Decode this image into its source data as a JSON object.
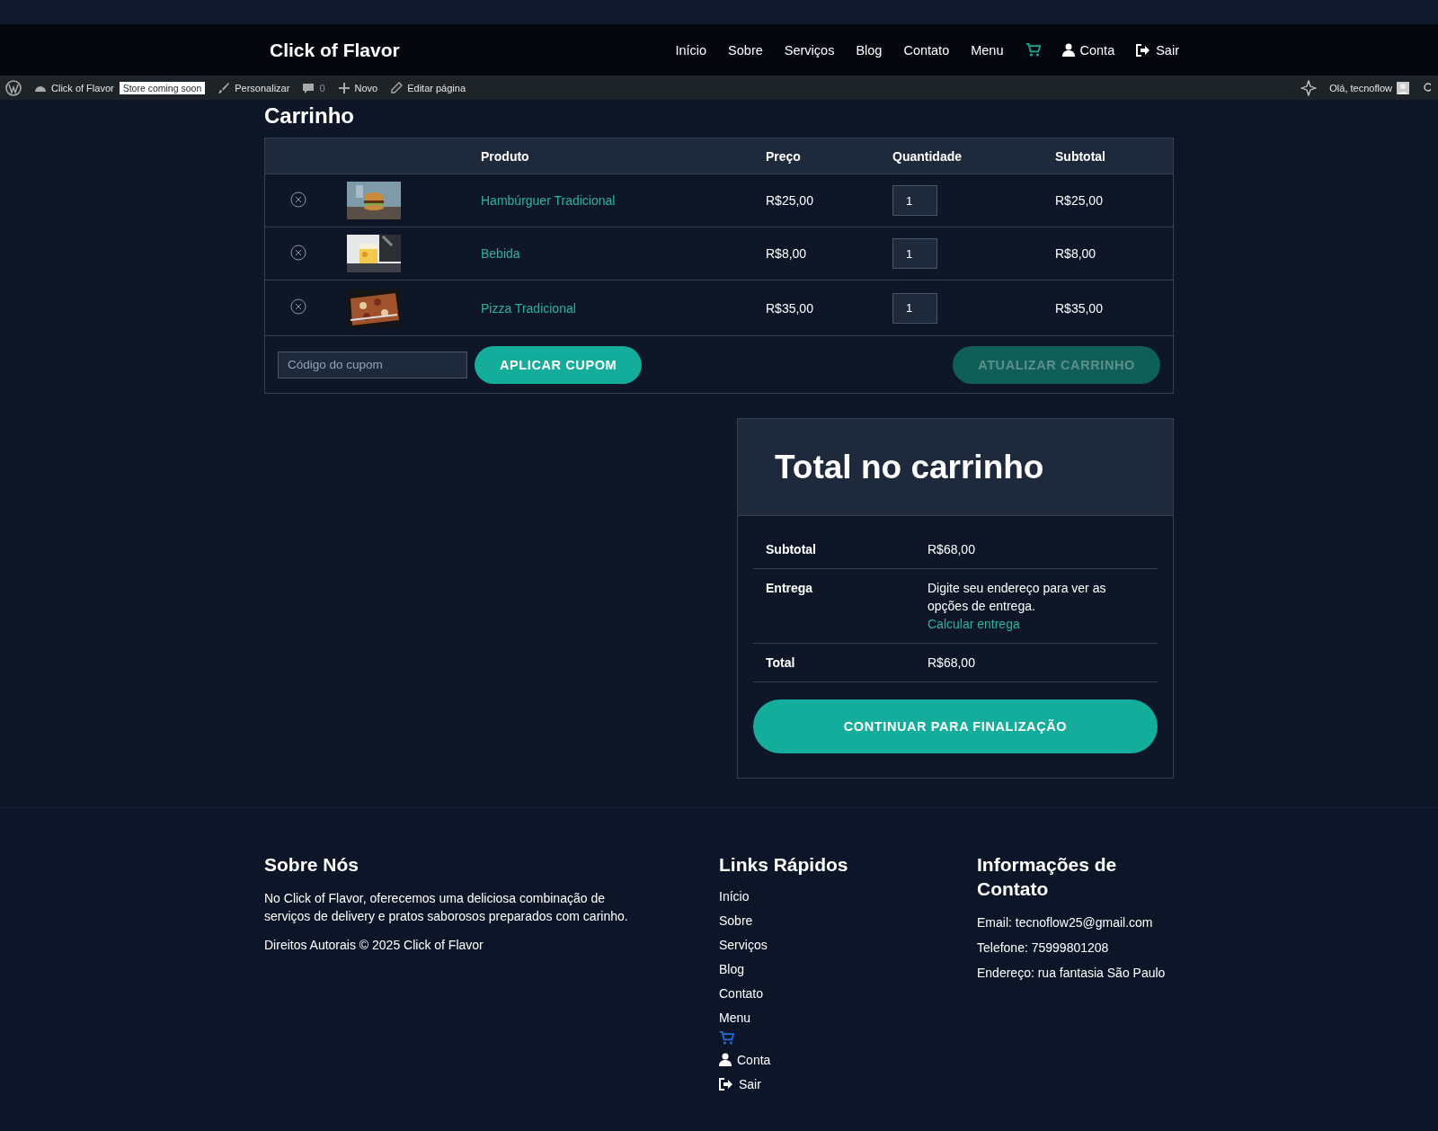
{
  "site": {
    "title": "Click of Flavor"
  },
  "nav": [
    {
      "kind": "text",
      "label": "Início"
    },
    {
      "kind": "text",
      "label": "Sobre"
    },
    {
      "kind": "text",
      "label": "Serviços"
    },
    {
      "kind": "text",
      "label": "Blog"
    },
    {
      "kind": "text",
      "label": "Contato"
    },
    {
      "kind": "text",
      "label": "Menu"
    },
    {
      "kind": "cart"
    },
    {
      "kind": "account",
      "label": "Conta"
    },
    {
      "kind": "logout",
      "label": "Sair"
    }
  ],
  "admin_bar": {
    "items": [
      {
        "kind": "wp"
      },
      {
        "kind": "site",
        "label": "Click of Flavor"
      },
      {
        "kind": "badge",
        "label": "Store coming soon"
      },
      {
        "kind": "customize",
        "label": "Personalizar"
      },
      {
        "kind": "comments",
        "label": "0"
      },
      {
        "kind": "new",
        "label": "Novo"
      },
      {
        "kind": "edit",
        "label": "Editar página"
      }
    ],
    "greeting": "Olá, tecnoflow"
  },
  "cart": {
    "heading": "Carrinho",
    "columns": [
      "Produto",
      "Preço",
      "Quantidade",
      "Subtotal"
    ],
    "rows": [
      {
        "product": "Hambúrguer Tradicional",
        "price": "R$25,00",
        "quantity": "1",
        "subtotal": "R$25,00"
      },
      {
        "product": "Bebida",
        "price": "R$8,00",
        "quantity": "1",
        "subtotal": "R$8,00"
      },
      {
        "product": "Pizza Tradicional",
        "price": "R$35,00",
        "quantity": "1",
        "subtotal": "R$35,00"
      }
    ],
    "coupon_placeholder": "Código do cupom",
    "apply_button": "APLICAR CUPOM",
    "update_button": {
      "label": "ATUALIZAR CARRINHO",
      "disabled": true
    }
  },
  "totals": {
    "title": "Total no carrinho",
    "rows": [
      {
        "label": "Subtotal",
        "value": "R$68,00"
      },
      {
        "label": "Entrega",
        "value": "Digite seu endereço para ver as opções de entrega.",
        "link": "Calcular entrega"
      },
      {
        "label": "Total",
        "value": "R$68,00"
      }
    ],
    "checkout_button": "CONTINUAR PARA FINALIZAÇÃO"
  },
  "footer": {
    "about": {
      "title": "Sobre Nós",
      "text": "No Click of Flavor, oferecemos uma deliciosa combinação de serviços de delivery e pratos saborosos preparados com carinho.",
      "copyright": "Direitos Autorais © 2025 Click of Flavor"
    },
    "links": {
      "title": "Links Rápidos",
      "items": [
        {
          "kind": "text",
          "label": "Início"
        },
        {
          "kind": "text",
          "label": "Sobre"
        },
        {
          "kind": "text",
          "label": "Serviços"
        },
        {
          "kind": "text",
          "label": "Blog"
        },
        {
          "kind": "text",
          "label": "Contato"
        },
        {
          "kind": "text",
          "label": "Menu"
        },
        {
          "kind": "cart"
        },
        {
          "kind": "account",
          "label": "Conta"
        },
        {
          "kind": "logout",
          "label": "Sair"
        }
      ]
    },
    "contact": {
      "title": "Informações de Contato",
      "lines": [
        "Email: tecnoflow25@gmail.com",
        "Telefone: 75999801208",
        "Endereço: rua fantasia São Paulo"
      ]
    }
  }
}
